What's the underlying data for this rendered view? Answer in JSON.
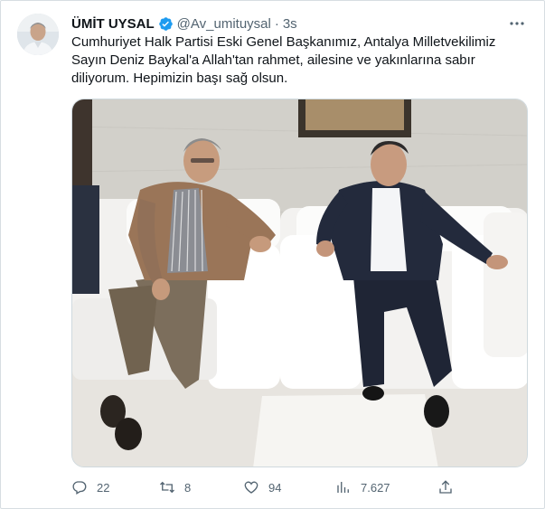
{
  "tweet": {
    "author_name": "ÜMİT UYSAL",
    "handle": "@Av_umituysal",
    "separator": "·",
    "time": "3s",
    "text": "Cumhuriyet Halk Partisi Eski Genel Başkanımız, Antalya Milletvekilimiz Sayın Deniz Baykal'a Allah'tan rahmet, ailesine ve yakınlarına sabır diliyorum. Hepimizin başı sağ olsun."
  },
  "actions": {
    "replies": "22",
    "retweets": "8",
    "likes": "94",
    "views": "7.627"
  },
  "colors": {
    "verified": "#1d9bf0",
    "secondary_text": "#536471",
    "primary_text": "#0f1419"
  }
}
